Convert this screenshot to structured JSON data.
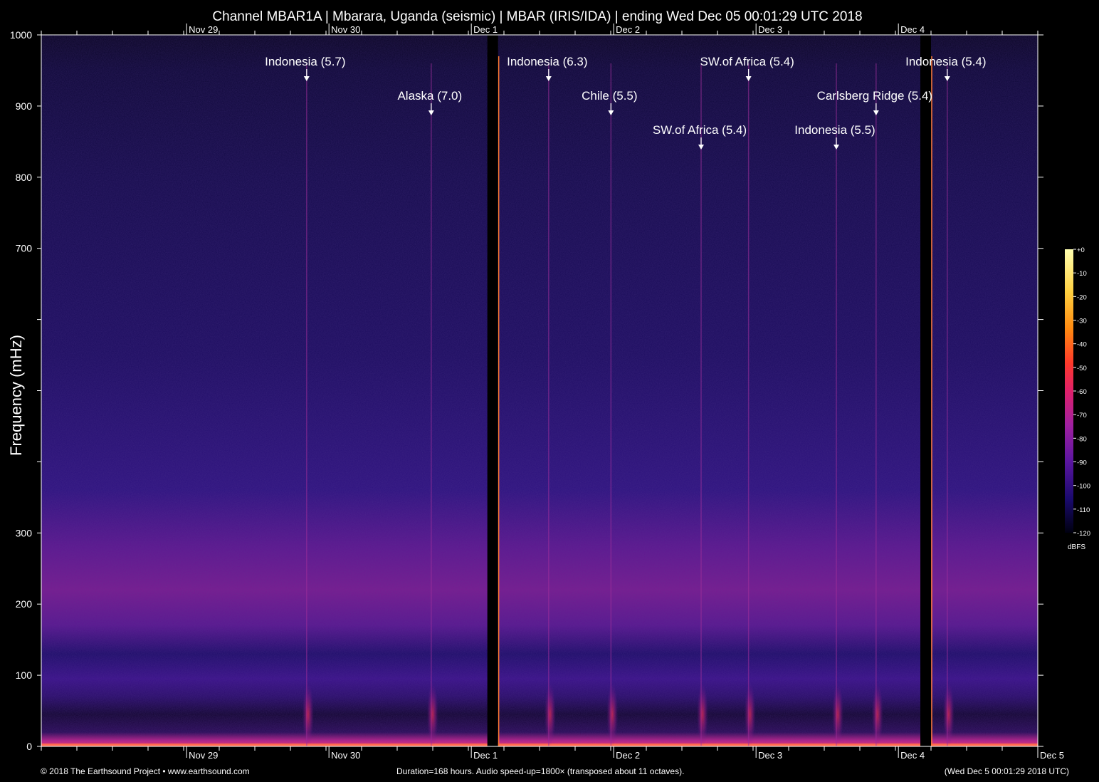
{
  "chart_data": {
    "type": "heatmap",
    "title": "Channel MBAR1A | Mbarara, Uganda (seismic) | MBAR (IRIS/IDA) | ending Wed Dec 05 00:01:29 UTC 2018",
    "xlabel": "",
    "ylabel": "Frequency (mHz)",
    "x_range_hours": [
      0,
      168
    ],
    "ylim": [
      0,
      1000
    ],
    "y_tick_values": [
      0,
      100,
      200,
      300,
      400,
      500,
      600,
      700,
      800,
      900,
      1000
    ],
    "y_tick_labels": [
      "0",
      "100",
      "200",
      "300",
      "",
      "",
      "",
      "700",
      "800",
      "900",
      "1000"
    ],
    "date_ticks": [
      {
        "label": "Nov 29",
        "hour": 24.5
      },
      {
        "label": "Nov 30",
        "hour": 48.5
      },
      {
        "label": "Dec  1",
        "hour": 72.5
      },
      {
        "label": "Dec  2",
        "hour": 96.5
      },
      {
        "label": "Dec  3",
        "hour": 120.5
      },
      {
        "label": "Dec  4",
        "hour": 144.5
      },
      {
        "label": "Dec  5",
        "hour": 168
      }
    ],
    "minor_tick_interval_hours": 6,
    "events": [
      {
        "label": "Indonesia (5.7)",
        "hour": 44.5,
        "row": 0
      },
      {
        "label": "Alaska (7.0)",
        "hour": 65.5,
        "row": 1
      },
      {
        "label": "Indonesia (6.3)",
        "hour": 85.3,
        "row": 0
      },
      {
        "label": "Chile (5.5)",
        "hour": 95.8,
        "row": 1
      },
      {
        "label": "SW.of Africa (5.4)",
        "hour": 111.0,
        "row": 2
      },
      {
        "label": "SW.of Africa (5.4)",
        "hour": 119.0,
        "row": 0
      },
      {
        "label": "Carlsberg Ridge (5.4)",
        "hour": 140.5,
        "row": 1
      },
      {
        "label": "Indonesia (5.5)",
        "hour": 133.8,
        "row": 2
      },
      {
        "label": "Indonesia (5.4)",
        "hour": 152.5,
        "row": 0
      }
    ],
    "data_gaps_hours": [
      [
        75.2,
        77.0
      ],
      [
        148.2,
        150.0
      ]
    ],
    "colorbar": {
      "unit": "dBFS",
      "range": [
        -120,
        0
      ],
      "tick_labels": [
        "+0",
        "-10",
        "-20",
        "-30",
        "-40",
        "-50",
        "-60",
        "-70",
        "-80",
        "-90",
        "-100",
        "-110",
        "-120"
      ],
      "colors": [
        "#000010",
        "#1a0a6e",
        "#5a15a0",
        "#a020a0",
        "#e0206a",
        "#ff3a2a",
        "#ff8a10",
        "#ffd040",
        "#ffffb0"
      ]
    }
  },
  "footer": {
    "copyright": "© 2018 The Earthsound Project • www.earthsound.com",
    "duration": "Duration=168 hours. Audio speed-up=1800× (transposed about 11 octaves).",
    "end_time": "(Wed Dec  5 00:01:29 2018 UTC)"
  }
}
